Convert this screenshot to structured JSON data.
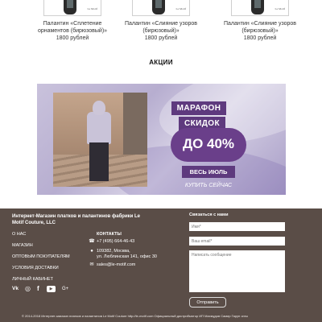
{
  "products": [
    {
      "name_line1": "Палантин «Сплетение",
      "name_line2": "орнаментов (бирюзовый)»",
      "price": "1800 рублей",
      "logo": "Le Motif"
    },
    {
      "name_line1": "Палантин «Слияние узоров",
      "name_line2": "(бирюзовый)»",
      "price": "1800 рублей",
      "logo": "Le Motif"
    },
    {
      "name_line1": "Палантин «Слияние узоров",
      "name_line2": "(бирюзовый)»",
      "price": "1800 рублей",
      "logo": "Le Motif"
    }
  ],
  "promo_section": {
    "title": "АКЦИИ",
    "marathon": "МАРАФОН",
    "discounts": "СКИДОК",
    "percent": "ДО 40%",
    "period": "ВЕСЬ ИЮЛЬ",
    "buy_now": "КУПИТЬ СЕЙЧАС",
    "accent_color": "#5e3a7e"
  },
  "footer": {
    "background_color": "#5a4d47",
    "title": "Интернет-Магазин платков и палантинов фабрики Le Motif Couture, LLC",
    "nav": [
      "О НАС",
      "МАГАЗИН",
      "ОПТОВЫМ ПОКУПАТЕЛЯМ",
      "УСЛОВИЯ ДОСТАВКИ",
      "ЛИЧНЫЙ КАБИНЕТ"
    ],
    "contacts_title": "КОНТАКТЫ",
    "phone": "+7 (495) 664-46-43",
    "address_line1": "109382, Москва,",
    "address_line2": "ул. Люблинская 141, офис 30",
    "email": "sales@le-motif.com",
    "social_icons": [
      "vk-icon",
      "instagram-icon",
      "facebook-icon",
      "youtube-icon",
      "google-plus-icon"
    ],
    "social_glyphs": [
      "Vk",
      "◎",
      "f",
      "▶",
      "G+"
    ],
    "contact_icons": [
      "phone-icon",
      "location-icon",
      "email-icon"
    ],
    "contact_glyphs": [
      "☎",
      "●",
      "✉"
    ],
    "form": {
      "title": "Связаться с нами",
      "name_placeholder": "Имя*",
      "email_placeholder": "Ваш email*",
      "message_placeholder": "Написать сообщение",
      "submit": "Отправить"
    },
    "copyright": "© 2014-2018 Интернет-магазин платков и палантинов Le Motif Couture http://le-motif.com Официальный дистрибьютор ИП Махмудов Самир Гарун оглы"
  }
}
